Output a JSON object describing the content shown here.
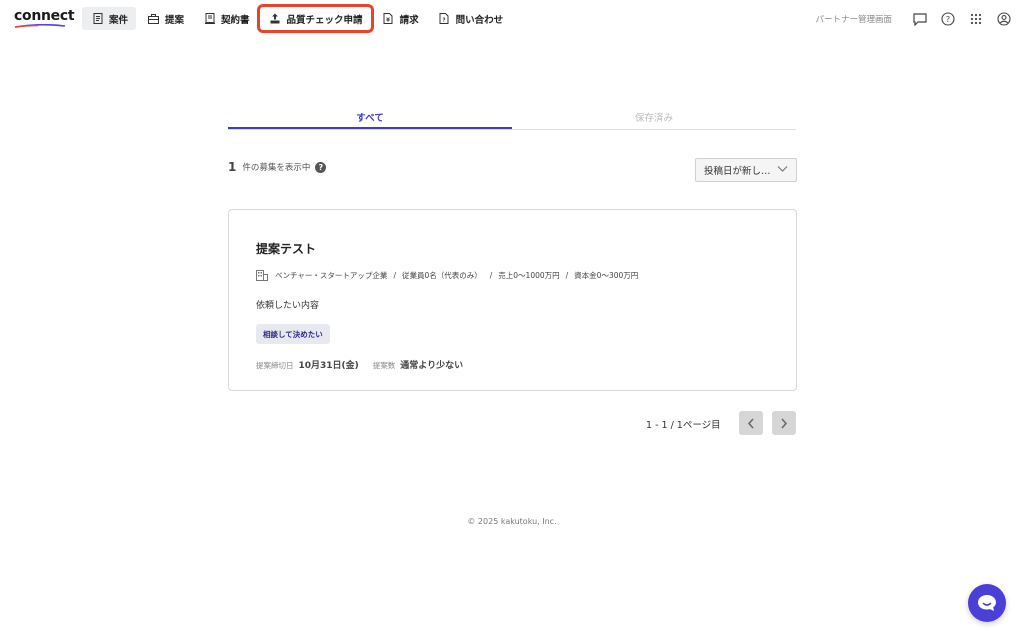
{
  "brand": {
    "name": "connect"
  },
  "nav": {
    "items": [
      {
        "label": "案件",
        "icon": "document-icon"
      },
      {
        "label": "提案",
        "icon": "briefcase-icon"
      },
      {
        "label": "契約書",
        "icon": "contract-icon"
      },
      {
        "label": "品質チェック申請",
        "icon": "upload-icon"
      },
      {
        "label": "請求",
        "icon": "invoice-icon"
      },
      {
        "label": "問い合わせ",
        "icon": "inquiry-icon"
      }
    ],
    "partner_link": "パートナー管理画面"
  },
  "tabs": [
    {
      "label": "すべて",
      "active": true
    },
    {
      "label": "保存済み",
      "active": false
    }
  ],
  "results": {
    "count": "1",
    "count_text": "件の募集を表示中",
    "help": "?"
  },
  "sort": {
    "selected": "投稿日が新し…"
  },
  "card": {
    "title": "提案テスト",
    "meta": {
      "company_type": "ベンチャー・スタートアップ企業",
      "sep": "/",
      "employees": "従業員0名（代表のみ）",
      "sales": "売上0〜1000万円",
      "capital": "資本金0〜300万円"
    },
    "description": "依頼したい内容",
    "tag": "相談して決めたい",
    "deadline_label": "提案締切日",
    "deadline_value": "10月31日(金)",
    "proposals_label": "提案数",
    "proposals_value": "通常より少ない"
  },
  "pagination": {
    "text": "1 - 1 / 1ページ目"
  },
  "footer": {
    "copyright": "© 2025 kakutoku, Inc."
  },
  "colors": {
    "accent": "#3b3bcc",
    "highlight": "#e8442d",
    "chat": "#4a3fd6"
  }
}
